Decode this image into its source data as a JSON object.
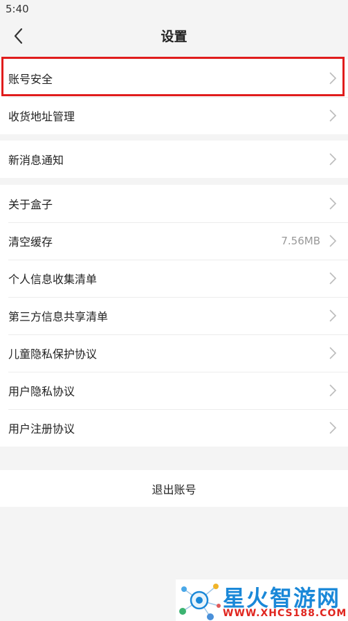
{
  "status_bar": {
    "time": "5:40"
  },
  "header": {
    "title": "设置",
    "back_icon": "chevron-left-icon"
  },
  "groups": [
    {
      "items": [
        {
          "label": "账号安全",
          "highlighted": true
        },
        {
          "label": "收货地址管理"
        }
      ]
    },
    {
      "items": [
        {
          "label": "新消息通知"
        }
      ]
    },
    {
      "items": [
        {
          "label": "关于盒子"
        },
        {
          "label": "清空缓存",
          "value": "7.56MB"
        },
        {
          "label": "个人信息收集清单"
        },
        {
          "label": "第三方信息共享清单"
        },
        {
          "label": "儿童隐私保护协议"
        },
        {
          "label": "用户隐私协议"
        },
        {
          "label": "用户注册协议"
        }
      ]
    }
  ],
  "logout": {
    "label": "退出账号"
  },
  "watermark": {
    "title": "星火智游网",
    "url": "WWW.XHCS188.COM"
  },
  "colors": {
    "highlight": "#e01c1c",
    "background": "#f4f4f4",
    "chevron": "#bbbbbb"
  }
}
